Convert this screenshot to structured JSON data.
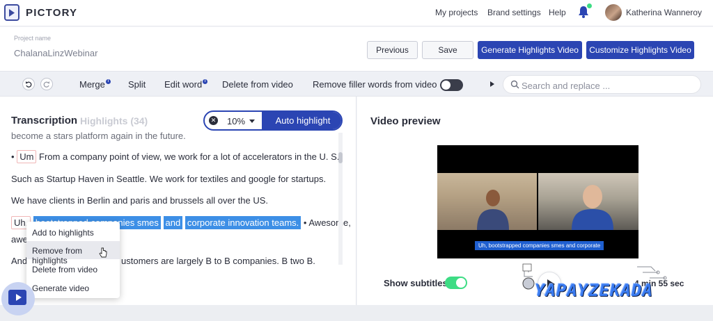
{
  "topnav": {
    "brand": "PICTORY",
    "links": [
      "My projects",
      "Brand settings",
      "Help"
    ],
    "user_name": "Katherina Wanneroy"
  },
  "project": {
    "label": "Project name",
    "name": "ChalanaLinzWebinar",
    "buttons": {
      "previous": "Previous",
      "save": "Save",
      "generate": "Generate Highlights Video",
      "customize": "Customize Highlights Video"
    }
  },
  "toolbar": {
    "merge": "Merge",
    "split": "Split",
    "edit_word": "Edit word",
    "delete": "Delete from video",
    "remove_filler": "Remove filler words from video",
    "filler_toggle": false,
    "search_placeholder": "Search and replace ..."
  },
  "transcription": {
    "tab_active": "Transcription",
    "tab_inactive": "Highlights (34)",
    "percent": "10%",
    "auto_highlight": "Auto highlight",
    "lines": {
      "l0": "become a stars platform again in the future.",
      "l1_bullet": "•",
      "l1_um": "Um",
      "l1_rest": "From a company point of view, we work for a lot of accelerators in the U. S.",
      "l2": "Such as Startup Haven in Seattle. We work for textiles and google for startups.",
      "l3": "We have clients in Berlin and paris and brussels all over the US.",
      "l4_uh": "Uh,",
      "l4_hl1": "bootstrapped companies smes",
      "l4_hl2": "and",
      "l4_hl3": "corporate innovation teams.",
      "l4_rest": "• Awesome,",
      "l5": "awe",
      "l6_start": "And",
      "l6_rest": "ustomers are largely B to B companies. B two B."
    }
  },
  "context_menu": {
    "items": [
      "Add to highlights",
      "Remove from highlights",
      "Delete from video",
      "Generate video"
    ],
    "hovered_index": 1
  },
  "video_preview": {
    "title": "Video preview",
    "caption": "Uh, bootstrapped companies smes and corporate",
    "show_subtitles_label": "Show subtitles",
    "show_subtitles": true,
    "duration": "4 min 55 sec"
  },
  "watermark": {
    "text": "YAPAYZEKADA"
  },
  "colors": {
    "primary": "#2b45b3",
    "highlight": "#3d8fe6",
    "toggle_on": "#3ddc84"
  }
}
